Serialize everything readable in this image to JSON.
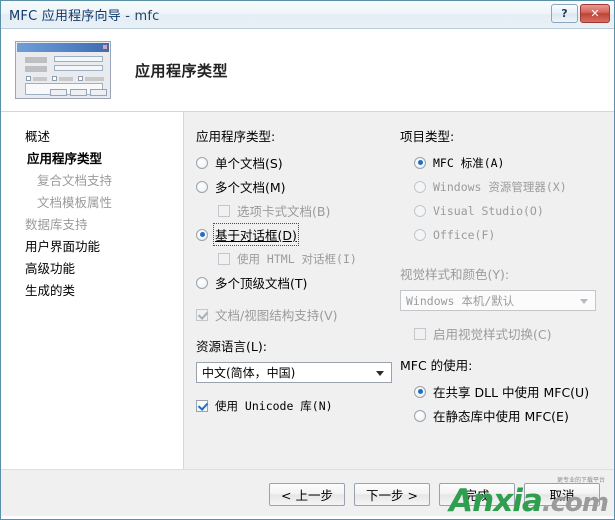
{
  "window": {
    "title": "MFC 应用程序向导",
    "title_separator": " - ",
    "title_project": "mfc",
    "help_button": "?",
    "close_button": "✕"
  },
  "header": {
    "title": "应用程序类型",
    "icon": "wizard-preview-icon"
  },
  "sidebar": {
    "items": [
      {
        "label": "概述",
        "state": "normal",
        "indent": 0
      },
      {
        "label": "应用程序类型",
        "state": "selected",
        "indent": 0
      },
      {
        "label": "复合文档支持",
        "state": "disabled",
        "indent": 1
      },
      {
        "label": "文档模板属性",
        "state": "disabled",
        "indent": 1
      },
      {
        "label": "数据库支持",
        "state": "disabled",
        "indent": 0
      },
      {
        "label": "用户界面功能",
        "state": "normal",
        "indent": 0
      },
      {
        "label": "高级功能",
        "state": "normal",
        "indent": 0
      },
      {
        "label": "生成的类",
        "state": "normal",
        "indent": 0
      }
    ]
  },
  "app_type": {
    "group_label": "应用程序类型:",
    "options": [
      {
        "label": "单个文档(S)",
        "selected": false,
        "disabled": false
      },
      {
        "label": "多个文档(M)",
        "selected": false,
        "disabled": false
      },
      {
        "label": "基于对话框(D)",
        "selected": true,
        "disabled": false,
        "focused": true
      },
      {
        "label": "多个顶级文档(T)",
        "selected": false,
        "disabled": false
      }
    ],
    "tabbed_documents": {
      "label": "选项卡式文档(B)",
      "checked": false,
      "disabled": true
    },
    "html_dialog": {
      "label": "使用 HTML 对话框(I)",
      "checked": false,
      "disabled": true
    },
    "doc_view_support": {
      "label": "文档/视图结构支持(V)",
      "checked": true,
      "disabled": true
    },
    "resource_language": {
      "label": "资源语言(L):",
      "value": "中文(简体，中国)"
    },
    "unicode_lib": {
      "label": "使用 Unicode 库(N)",
      "checked": true,
      "disabled": false
    }
  },
  "project_type": {
    "group_label": "项目类型:",
    "options": [
      {
        "label": "MFC 标准(A)",
        "selected": true,
        "disabled": false
      },
      {
        "label": "Windows 资源管理器(X)",
        "selected": false,
        "disabled": true
      },
      {
        "label": "Visual Studio(O)",
        "selected": false,
        "disabled": true
      },
      {
        "label": "Office(F)",
        "selected": false,
        "disabled": true
      }
    ],
    "visual_style": {
      "label": "视觉样式和颜色(Y):",
      "value": "Windows 本机/默认",
      "disabled": true
    },
    "enable_style_switch": {
      "label": "启用视觉样式切换(C)",
      "checked": false,
      "disabled": true
    },
    "mfc_usage": {
      "group_label": "MFC 的使用:",
      "options": [
        {
          "label": "在共享 DLL 中使用 MFC(U)",
          "selected": true,
          "disabled": false
        },
        {
          "label": "在静态库中使用 MFC(E)",
          "selected": false,
          "disabled": false
        }
      ]
    }
  },
  "footer": {
    "buttons": [
      {
        "label": "< 上一步",
        "name": "back-button"
      },
      {
        "label": "下一步 >",
        "name": "next-button"
      },
      {
        "label": "完成",
        "name": "finish-button"
      },
      {
        "label": "取消",
        "name": "cancel-button"
      }
    ]
  },
  "watermark": {
    "brand": "Anxia",
    "tld": ".com",
    "tagline": "更专业的下载平台",
    "brand_color": "#2f9e4f"
  }
}
